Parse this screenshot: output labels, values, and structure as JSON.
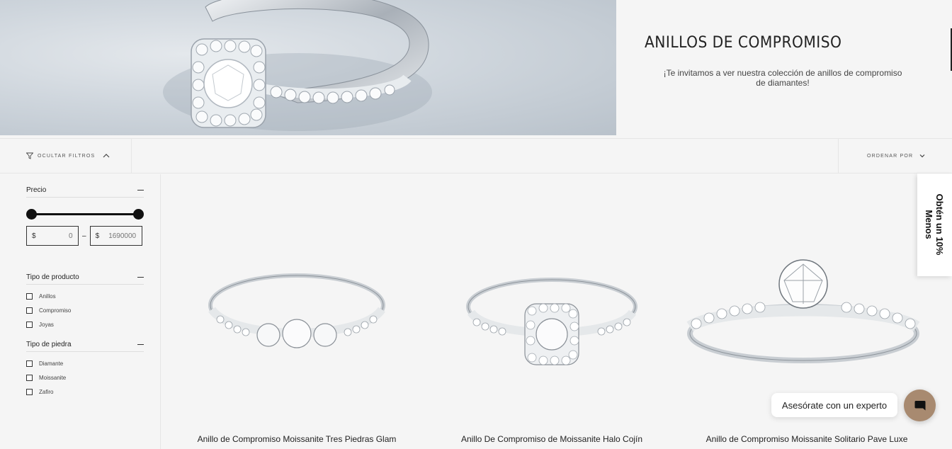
{
  "hero": {
    "title": "ANILLOS DE COMPROMISO",
    "subtitle": "¡Te invitamos a ver nuestra colección de anillos de compromiso de diamantes!"
  },
  "filterbar": {
    "toggle_label": "OCULTAR FILTROS",
    "order_label": "ORDENAR POR"
  },
  "filters": {
    "price": {
      "title": "Precio",
      "currency": "$",
      "min_placeholder": "0",
      "max_placeholder": "1690000",
      "separator": "–"
    },
    "product_type": {
      "title": "Tipo de producto",
      "options": [
        "Anillos",
        "Compromiso",
        "Joyas"
      ]
    },
    "stone_type": {
      "title": "Tipo de piedra",
      "options": [
        "Diamante",
        "Moissanite",
        "Zafiro"
      ]
    }
  },
  "products": [
    {
      "title": "Anillo de Compromiso Moissanite Tres Piedras Glam"
    },
    {
      "title": "Anillo De Compromiso de Moissanite Halo Cojín"
    },
    {
      "title": "Anillo de Compromiso Moissanite Solitario Pave Luxe"
    }
  ],
  "promo": {
    "text": "Obtén un 10%\nMenos"
  },
  "chat": {
    "label": "Asesórate con un experto"
  },
  "colors": {
    "accent": "#a88a70",
    "background": "#f5f5f5"
  }
}
